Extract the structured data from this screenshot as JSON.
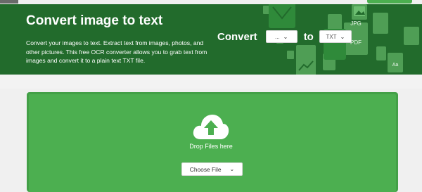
{
  "hero": {
    "title": "Convert image to text",
    "description": "Convert your images to text. Extract text from images, photos, and other pictures. This free OCR converter allows you to grab text from images and convert it to a plain text TXT file.",
    "convert_label": "Convert",
    "to_label": "to",
    "from_select": {
      "selected": "..."
    },
    "to_select": {
      "selected": "TXT"
    },
    "deco_file_labels": [
      "JPG",
      "PDF",
      "Aa"
    ]
  },
  "dropzone": {
    "drop_text": "Drop Files here",
    "choose_button": "Choose File"
  },
  "colors": {
    "hero_bg": "#226b2c",
    "dropzone_bg": "#4caf50",
    "page_bg": "#f0f0f0"
  },
  "icons": [
    "cloud-upload-icon",
    "chevron-down-icon",
    "file-icon",
    "chart-icon",
    "image-icon",
    "mail-icon"
  ]
}
